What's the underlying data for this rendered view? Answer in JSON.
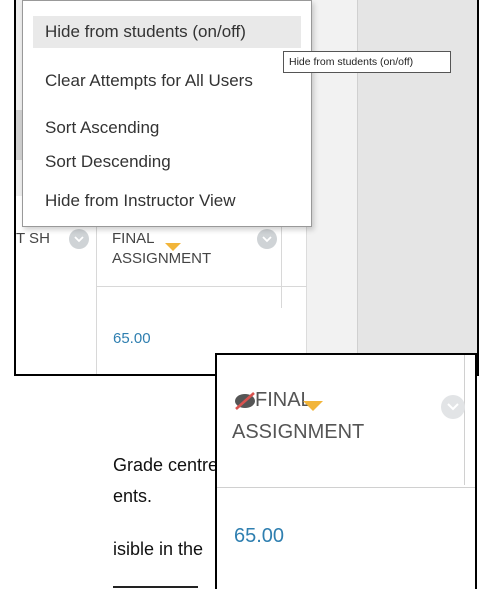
{
  "menu": {
    "items": [
      {
        "label": "Hide from students (on/off)",
        "active": true
      },
      {
        "label": "Clear Attempts for All Users",
        "active": false
      },
      {
        "label": "Sort Ascending",
        "active": false
      },
      {
        "label": "Sort Descending",
        "active": false
      },
      {
        "label": "Hide from Instructor View",
        "active": false
      }
    ]
  },
  "tooltip": "Hide from students (on/off)",
  "grade_table": {
    "prev_column_header": "T SH",
    "column_header_line1": "FINAL",
    "column_header_line2": "ASSIGNMENT",
    "cell_value": "65.00"
  },
  "zoom_inset": {
    "header_line1": "FINAL",
    "header_line2": "ASSIGNMENT",
    "value": "65.00",
    "hidden_icon": "eye-slash-icon",
    "arrow_color": "#f2b53a"
  },
  "instruction_text": {
    "line1": "Grade centre",
    "line2": "ents.",
    "line3": "isible in the"
  },
  "colors": {
    "link_blue": "#2f7fb0",
    "sort_arrow": "#f2b53a",
    "hidden_icon_red": "#d9534f"
  }
}
